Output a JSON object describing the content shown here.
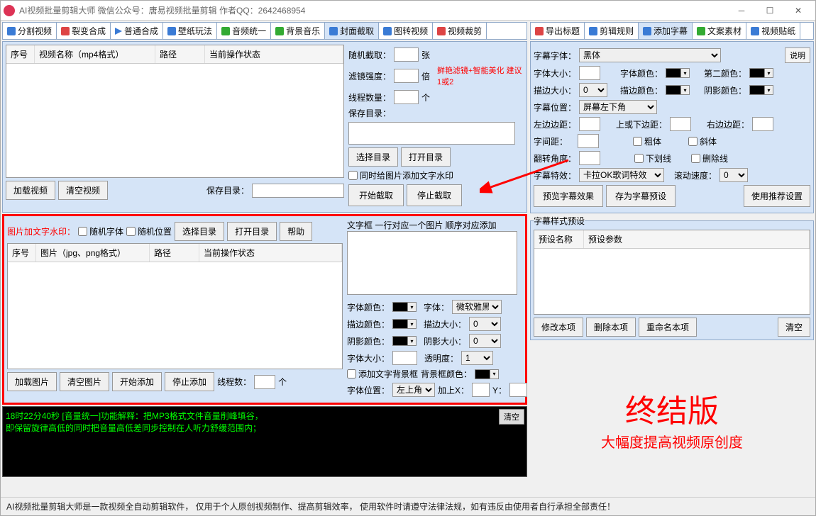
{
  "title": "AI视频批量剪辑大师    微信公众号：唐易视频批量剪辑    作者QQ：2642468954",
  "left_tabs": [
    "分割视频",
    "裂变合成",
    "普通合成",
    "壁纸玩法",
    "音频统一",
    "背景音乐",
    "封面截取",
    "图转视频",
    "视频裁剪"
  ],
  "right_tabs": [
    "导出标题",
    "剪辑规则",
    "添加字幕",
    "文案素材",
    "视频贴纸"
  ],
  "video_table": {
    "cols": [
      "序号",
      "视频名称（mp4格式）",
      "路径",
      "当前操作状态"
    ]
  },
  "btn_load_video": "加载视频",
  "btn_clear_video": "清空视频",
  "lbl_save_dir": "保存目录：",
  "cover": {
    "rand_cap": "随机截取：",
    "rand_unit": "张",
    "filter": "滤镜强度：",
    "filter_unit": "倍",
    "filter_tip": "鲜艳滤镜+智能美化 建议1或2",
    "threads": "线程数量：",
    "threads_unit": "个",
    "savedir": "保存目录：",
    "btn_sel": "选择目录",
    "btn_open": "打开目录",
    "chk_wm": "同时给图片添加文字水印",
    "btn_start": "开始截取",
    "btn_stop": "停止截取"
  },
  "wm": {
    "title": "图片加文字水印：",
    "rand_font": "随机字体",
    "rand_pos": "随机位置",
    "btn_sel": "选择目录",
    "btn_open": "打开目录",
    "btn_help": "帮助",
    "cols": [
      "序号",
      "图片（jpg、png格式）",
      "路径",
      "当前操作状态"
    ],
    "btn_load": "加载图片",
    "btn_clear": "清空图片",
    "btn_start": "开始添加",
    "btn_stop": "停止添加",
    "threads_lbl": "线程数：",
    "threads_unit": "个",
    "text_title": "文字框 一行对应一个图片 顺序对应添加",
    "font_color": "字体颜色：",
    "font_lbl": "字体：",
    "font_val": "微软雅黑",
    "stroke_color": "描边颜色：",
    "stroke_size": "描边大小：",
    "stroke_val": "0",
    "shadow_color": "阴影颜色：",
    "shadow_size": "阴影大小：",
    "shadow_val": "0",
    "font_size": "字体大小：",
    "opacity": "透明度：",
    "opacity_val": "1",
    "add_bg": "添加文字背景框",
    "bg_color": "背景框颜色：",
    "pos": "字体位置：",
    "pos_val": "左上角",
    "addx": "加上X：",
    "addy": "Y："
  },
  "sub": {
    "explain": "说明",
    "font": "字幕字体：",
    "font_val": "黑体",
    "size": "字体大小：",
    "color": "字体颜色：",
    "color2": "第二颜色：",
    "stroke": "描边大小：",
    "stroke_val": "0",
    "stroke_c": "描边颜色：",
    "shadow_c": "阴影颜色：",
    "pos": "字幕位置：",
    "pos_val": "屏幕左下角",
    "ml": "左边边距：",
    "mt": "上或下边距：",
    "mr": "右边边距：",
    "spacing": "字间距：",
    "bold": "粗体",
    "italic": "斜体",
    "angle": "翻转角度：",
    "underline": "下划线",
    "strike": "删除线",
    "fx": "字幕特效：",
    "fx_val": "卡拉OK歌词特效",
    "speed": "滚动速度：",
    "speed_val": "0",
    "btn_prev": "预览字幕效果",
    "btn_save": "存为字幕预设",
    "btn_rec": "使用推荐设置",
    "preset_title": "字幕样式预设",
    "preset_cols": [
      "预设名称",
      "预设参数"
    ],
    "btn_mod": "修改本项",
    "btn_del": "删除本项",
    "btn_ren": "重命名本项",
    "btn_clr": "清空"
  },
  "log_line1": "18时22分40秒 [音量统一]功能解释：把MP3格式文件音量削峰填谷，",
  "log_line2": "        即保留旋律高低的同时把音量高低差同步控制在人听力舒缓范围内；",
  "log_clear": "清空",
  "banner_big": "终结版",
  "banner_sub": "大幅度提高视频原创度",
  "footer": "AI视频批量剪辑大师是一款视频全自动剪辑软件，  仅用于个人原创视频制作、提高剪辑效率，  使用软件时请遵守法律法规，如有违反由使用者自行承担全部责任！"
}
